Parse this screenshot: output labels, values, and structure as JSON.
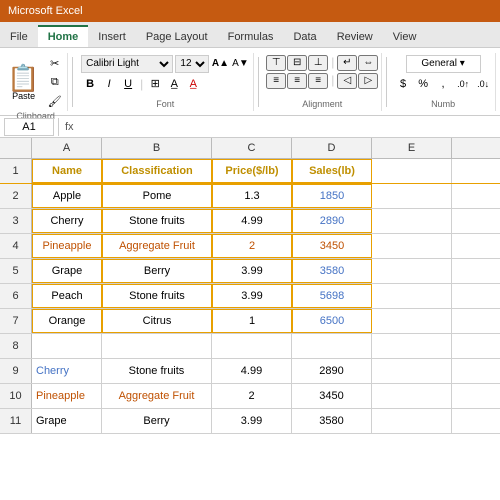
{
  "titlebar": {
    "title": "Microsoft Excel"
  },
  "ribbon": {
    "tabs": [
      "File",
      "Home",
      "Insert",
      "Page Layout",
      "Formulas",
      "Data",
      "Review",
      "View"
    ],
    "active_tab": "Home",
    "font_name": "Calibri Light",
    "font_size": "12",
    "groups": {
      "clipboard": "Clipboard",
      "font": "Font",
      "alignment": "Alignment",
      "number": "Numb"
    }
  },
  "formula_bar": {
    "name_box": "A1",
    "formula": ""
  },
  "columns": [
    "A",
    "B",
    "C",
    "D",
    "E"
  ],
  "spreadsheet": {
    "headers": {
      "name": "Name",
      "classification": "Classification",
      "price": "Price($/lb)",
      "sales": "Sales(lb)"
    },
    "main_table": [
      {
        "row": 2,
        "name": "Apple",
        "classification": "Pome",
        "price": "1.3",
        "sales": "1850"
      },
      {
        "row": 3,
        "name": "Cherry",
        "classification": "Stone fruits",
        "price": "4.99",
        "sales": "2890"
      },
      {
        "row": 4,
        "name": "Pineapple",
        "classification": "Aggregate Fruit",
        "price": "2",
        "sales": "3450"
      },
      {
        "row": 5,
        "name": "Grape",
        "classification": "Berry",
        "price": "3.99",
        "sales": "3580"
      },
      {
        "row": 6,
        "name": "Peach",
        "classification": "Stone fruits",
        "price": "3.99",
        "sales": "5698"
      },
      {
        "row": 7,
        "name": "Orange",
        "classification": "Citrus",
        "price": "1",
        "sales": "6500"
      }
    ],
    "bottom_table": [
      {
        "row": 9,
        "name": "Cherry",
        "classification": "Stone fruits",
        "price": "4.99",
        "sales": "2890"
      },
      {
        "row": 10,
        "name": "Pineapple",
        "classification": "Aggregate Fruit",
        "price": "2",
        "sales": "3450"
      },
      {
        "row": 11,
        "name": "Grape",
        "classification": "Berry",
        "price": "3.99",
        "sales": "3580"
      }
    ]
  }
}
